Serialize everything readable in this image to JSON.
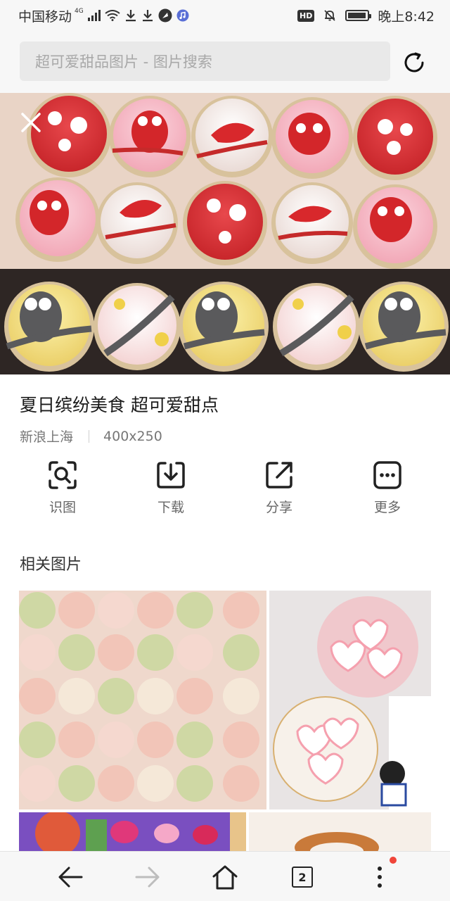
{
  "status_bar": {
    "carrier": "中国移动",
    "network": "4G",
    "hd_badge": "HD",
    "time": "晚上8:42"
  },
  "search": {
    "placeholder": "超可爱甜品图片 - 图片搜索"
  },
  "detail": {
    "title": "夏日缤纷美食 超可爱甜点",
    "source": "新浪上海",
    "dimensions": "400x250"
  },
  "actions": [
    {
      "label": "识图",
      "icon": "image-scan-icon"
    },
    {
      "label": "下载",
      "icon": "download-icon"
    },
    {
      "label": "分享",
      "icon": "share-icon"
    },
    {
      "label": "更多",
      "icon": "more-icon"
    }
  ],
  "related": {
    "title": "相关图片"
  },
  "bottom_nav": {
    "tab_count": "2"
  },
  "colors": {
    "accent_red": "#f0453a",
    "bar_bg": "#f7f7f7",
    "search_bg": "#e9e9e9"
  }
}
